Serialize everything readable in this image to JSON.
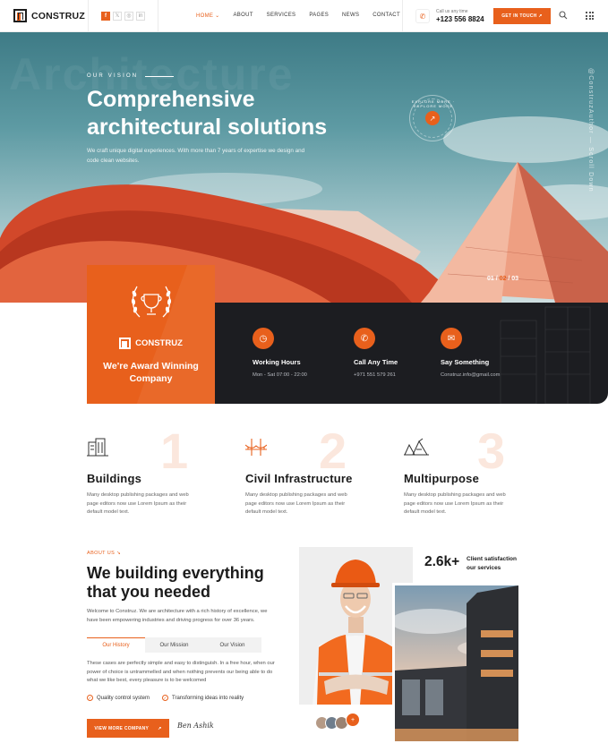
{
  "brand": {
    "name": "CONSTRUZ"
  },
  "header": {
    "socials": [
      "f",
      "𝕏",
      "◎",
      "in"
    ],
    "nav": [
      {
        "label": "HOME ⌄",
        "active": true
      },
      {
        "label": "ABOUT",
        "active": false
      },
      {
        "label": "SERVICES",
        "active": false
      },
      {
        "label": "PAGES",
        "active": false
      },
      {
        "label": "NEWS",
        "active": false
      },
      {
        "label": "CONTACT",
        "active": false
      }
    ],
    "call_label": "Call us any time",
    "call_number": "+123 556 8824",
    "cta_label": "GET IN TOUCH ↗"
  },
  "hero": {
    "watermark": "Architecture",
    "eyebrow": "OUR VISION",
    "title": "Comprehensive architectural solutions",
    "description": "We craft unique digital experiences. With more than 7 years of expertise we design and code clean websites.",
    "explore_label": "EXPLORE MORE · EXPLORE MORE",
    "side_text": "@ConstruzAuthor — Scroll Down",
    "slider": {
      "current": "01",
      "next": "02",
      "total": "03"
    }
  },
  "award": {
    "logo_text": "CONSTRUZ",
    "title": "We're Award Winning Company"
  },
  "features": [
    {
      "icon": "clock-icon",
      "glyph": "◷",
      "title": "Working Hours",
      "text": "Mon - Sat 07:00 - 22:00"
    },
    {
      "icon": "phone-icon",
      "glyph": "✆",
      "title": "Call Any Time",
      "text": "+971 551 579 261"
    },
    {
      "icon": "mail-icon",
      "glyph": "✉",
      "title": "Say Something",
      "text": "Construz.info@gmail.com"
    }
  ],
  "services": [
    {
      "num": "1",
      "title": "Buildings",
      "text": "Many desktop publishing packages and web page editors now use Lorem Ipsum as their default model text."
    },
    {
      "num": "2",
      "title": "Civil Infrastructure",
      "text": "Many desktop publishing packages and web page editors now use Lorem Ipsum as their default model text."
    },
    {
      "num": "3",
      "title": "Multipurpose",
      "text": "Many desktop publishing packages and web page editors now use Lorem Ipsum as their default model text."
    }
  ],
  "about": {
    "eyebrow": "ABOUT US ↘",
    "title": "We building everything that you needed",
    "description": "Welcome to Construz. We are architecture with a rich history of excellence, we have been empowering industries and driving progress for over 36 years.",
    "tabs": [
      "Our History",
      "Our Mission",
      "Our Vision"
    ],
    "tab_text": "These cases are perfectly simple and easy to distinguish. In a free hour, when our power of choice is untrammelled and when nothing prevents our being able to do what we like best, every pleasure is to be welcomed",
    "checks": [
      "Quality control system",
      "Transforming ideas into reality"
    ],
    "button": "VIEW MORE COMPANY",
    "signature": "Ben Ashik",
    "stat_number": "2.6k+",
    "stat_label": "Client satisfaction our services"
  },
  "colors": {
    "accent": "#e8601c",
    "dark": "#1c1d21"
  }
}
